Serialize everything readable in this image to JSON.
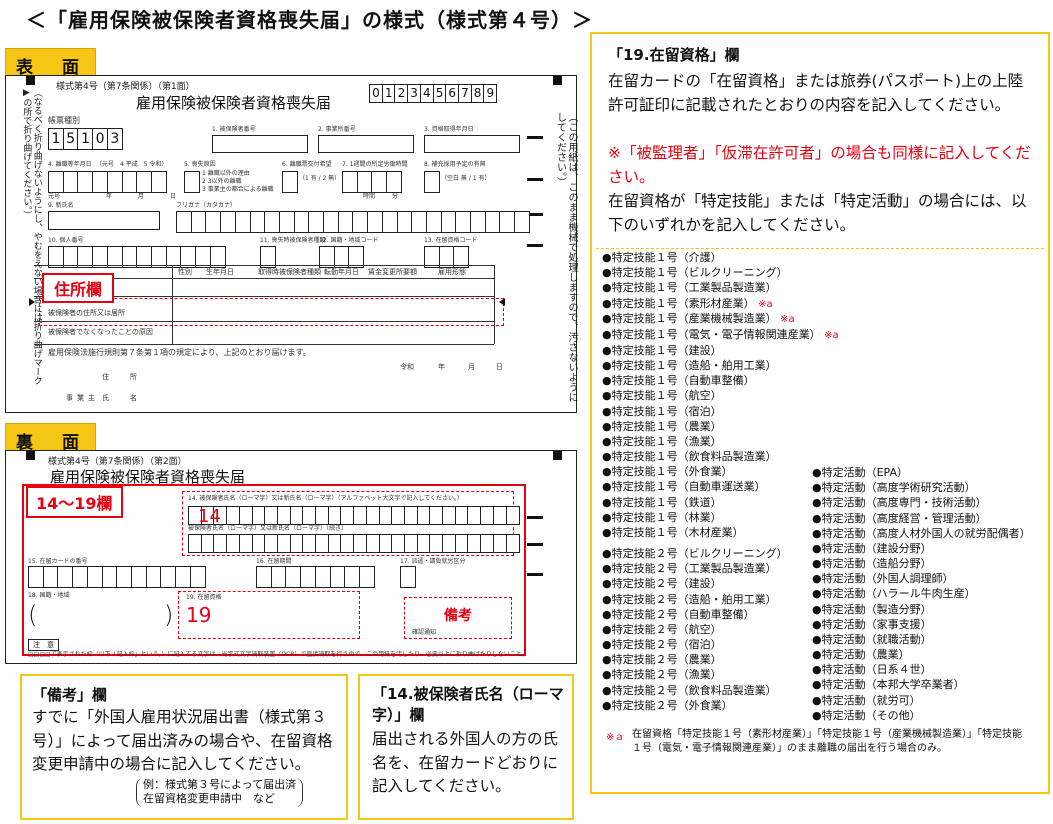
{
  "page_title": "＜「雇用保険被保険者資格喪失届」の様式（様式第４号）＞",
  "front": {
    "tag": "表　面",
    "form_header": "様式第4号（第7条関係）（第1面）",
    "form_title": "雇用保険被保険者資格喪失届",
    "kind_code_label": "帳票種別",
    "kind_code_value": [
      "1",
      "5",
      "1",
      "0",
      "3"
    ],
    "field_labels": {
      "f1": "1. 被保険者番号",
      "f2": "2. 事業所番号",
      "f3": "3. 資格取得年月日",
      "f4": "4. 離職等年月日",
      "f5": "5. 喪失原因",
      "f6": "6. 離職票交付希望",
      "f7": "7. 1週間の所定労働時間",
      "f8": "8. 補充採用予定の有無",
      "f9": "9. 新氏名",
      "f9kana": "フリガナ（カタカナ）",
      "f10": "10. 個人番号",
      "f11": "11. 喪失時被保険者種類",
      "f12": "12. 国籍・地域コード",
      "f13": "13. 在留資格コード"
    },
    "era_note": "（元号　4 平成　5 令和）",
    "reason_options": [
      "1 離職以外の理由",
      "2 3以外の離職",
      "3 事業主の都合による離職"
    ],
    "yesno": "（1 有 / 2 無）",
    "fill_in": "（空白 無 / 1 有）",
    "time_labels": [
      "時間",
      "分"
    ],
    "date_labels": [
      "元号",
      "年",
      "月",
      "日"
    ],
    "note_vertical": "（なるべく折り曲げないようにし、やむをえない場合には折り曲げマーク▶の所で折り曲げてください。）",
    "right_vertical": "（この用紙は、このまま機械で処理しますので、汚さないようにしてください。）",
    "table_headers": [
      "性別",
      "生年月日",
      "取得時被保険者種類",
      "転勤年月日",
      "賃金変更所要額",
      "雇用形態"
    ],
    "table_row1": "被保険者の住所又は居所",
    "table_row2": "被保険者でなくなったことの原因",
    "address_label": "住所欄",
    "law_line": "雇用保険法施行規則第７条第１項の規定により、上記のとおり届けます。",
    "date_line": [
      "令和",
      "年",
      "月",
      "日"
    ],
    "signers": [
      "住",
      "所",
      "事業主",
      "氏",
      "名"
    ]
  },
  "back": {
    "tag": "裏　面",
    "form_header": "様式第4号（第7条関係）（第2面）",
    "form_title": "雇用保険被保険者資格喪失届",
    "label_14_19": "14〜19欄",
    "f14": "14. 被保険者氏名（ローマ字）又は新氏名（ローマ字）（アルファベット大文字で記入してください。）",
    "f14_sub": "被保険者氏名（ローマ字）又は新氏名（ローマ字）〔続き〕",
    "num_14": "14",
    "f15": "15. 在留カードの番号",
    "f16": "16. 在留期間",
    "f17": "17. 派遣・請負就労区分",
    "f18": "18. 国籍・地域",
    "f19": "19. 在留資格",
    "num_19": "19",
    "remarks_label": "備考",
    "remarks_sub": "確認通知",
    "note_label": "注　意",
    "note_text": "□□□□で表示された枠（以下「記入枠」という。）に記入する文字は、光学式文字読取装置（OCR）で直接読取を行うので、この用紙を汚したり、必要以上に折り曲げたりしないこと。"
  },
  "remarks_box": {
    "title": "「備考」欄",
    "text": "すでに「外国人雇用状況届出書（様式第３号）」によって届出済みの場合や、在留資格変更申請中の場合に記入してください。",
    "example": "例：様式第３号によって届出済\n在留資格変更申請中　など"
  },
  "name_box": {
    "title": "「14.被保険者氏名（ローマ字）」欄",
    "text": "届出される外国人の方の氏名を、在留カードどおりに記入してください。"
  },
  "status_box": {
    "title": "「19.在留資格」欄",
    "text1": "在留カードの「在留資格」または旅券(パスポート)上の上陸許可証印に記載されたとおりの内容を記入してください。",
    "text_red": "※「被監理者」「仮滞在許可者」の場合も同様に記入してください。",
    "text2": "在留資格が「特定技能」または「特定活動」の場合には、以下のいずれかを記入してください。",
    "list_left_1": [
      "●特定技能１号（介護）",
      "●特定技能１号（ビルクリーニング）",
      "●特定技能１号（工業製品製造業）",
      "●特定技能１号（素形材産業）",
      "●特定技能１号（産業機械製造業）",
      "●特定技能１号（電気・電子情報関連産業）",
      "●特定技能１号（建設）",
      "●特定技能１号（造船・舶用工業）",
      "●特定技能１号（自動車整備）",
      "●特定技能１号（航空）",
      "●特定技能１号（宿泊）",
      "●特定技能１号（農業）",
      "●特定技能１号（漁業）",
      "●特定技能１号（飲食料品製造業）",
      "●特定技能１号（外食業）",
      "●特定技能１号（自動車運送業）",
      "●特定技能１号（鉄道）",
      "●特定技能１号（林業）",
      "●特定技能１号（木材産業）"
    ],
    "note_marker": "※a",
    "list_left_2": [
      "●特定技能２号（ビルクリーニング）",
      "●特定技能２号（工業製品製造業）",
      "●特定技能２号（建設）",
      "●特定技能２号（造船・舶用工業）",
      "●特定技能２号（自動車整備）",
      "●特定技能２号（航空）",
      "●特定技能２号（宿泊）",
      "●特定技能２号（農業）",
      "●特定技能２号（漁業）",
      "●特定技能２号（飲食料品製造業）",
      "●特定技能２号（外食業）"
    ],
    "list_right": [
      "●特定活動（EPA）",
      "●特定活動（高度学術研究活動）",
      "●特定活動（高度専門・技術活動）",
      "●特定活動（高度経営・管理活動）",
      "●特定活動（高度人材外国人の就労配偶者）",
      "●特定活動（建設分野）",
      "●特定活動（造船分野）",
      "●特定活動（外国人調理師）",
      "●特定活動（ハラール牛肉生産）",
      "●特定活動（製造分野）",
      "●特定活動（家事支援）",
      "●特定活動（就職活動）",
      "●特定活動（農業）",
      "●特定活動（日系４世）",
      "●特定活動（本邦大学卒業者）",
      "●特定活動（就労可）",
      "●特定活動（その他）"
    ],
    "footnote_marker": "※ａ",
    "footnote": "在留資格「特定技能１号（素形材産業）」「特定技能１号（産業機械製造業）」「特定技能１号（電気・電子情報関連産業）」のまま離職の届出を行う場合のみ。"
  },
  "colors": {
    "accent_yellow": "#f6c516",
    "alert_red": "#e60012"
  }
}
